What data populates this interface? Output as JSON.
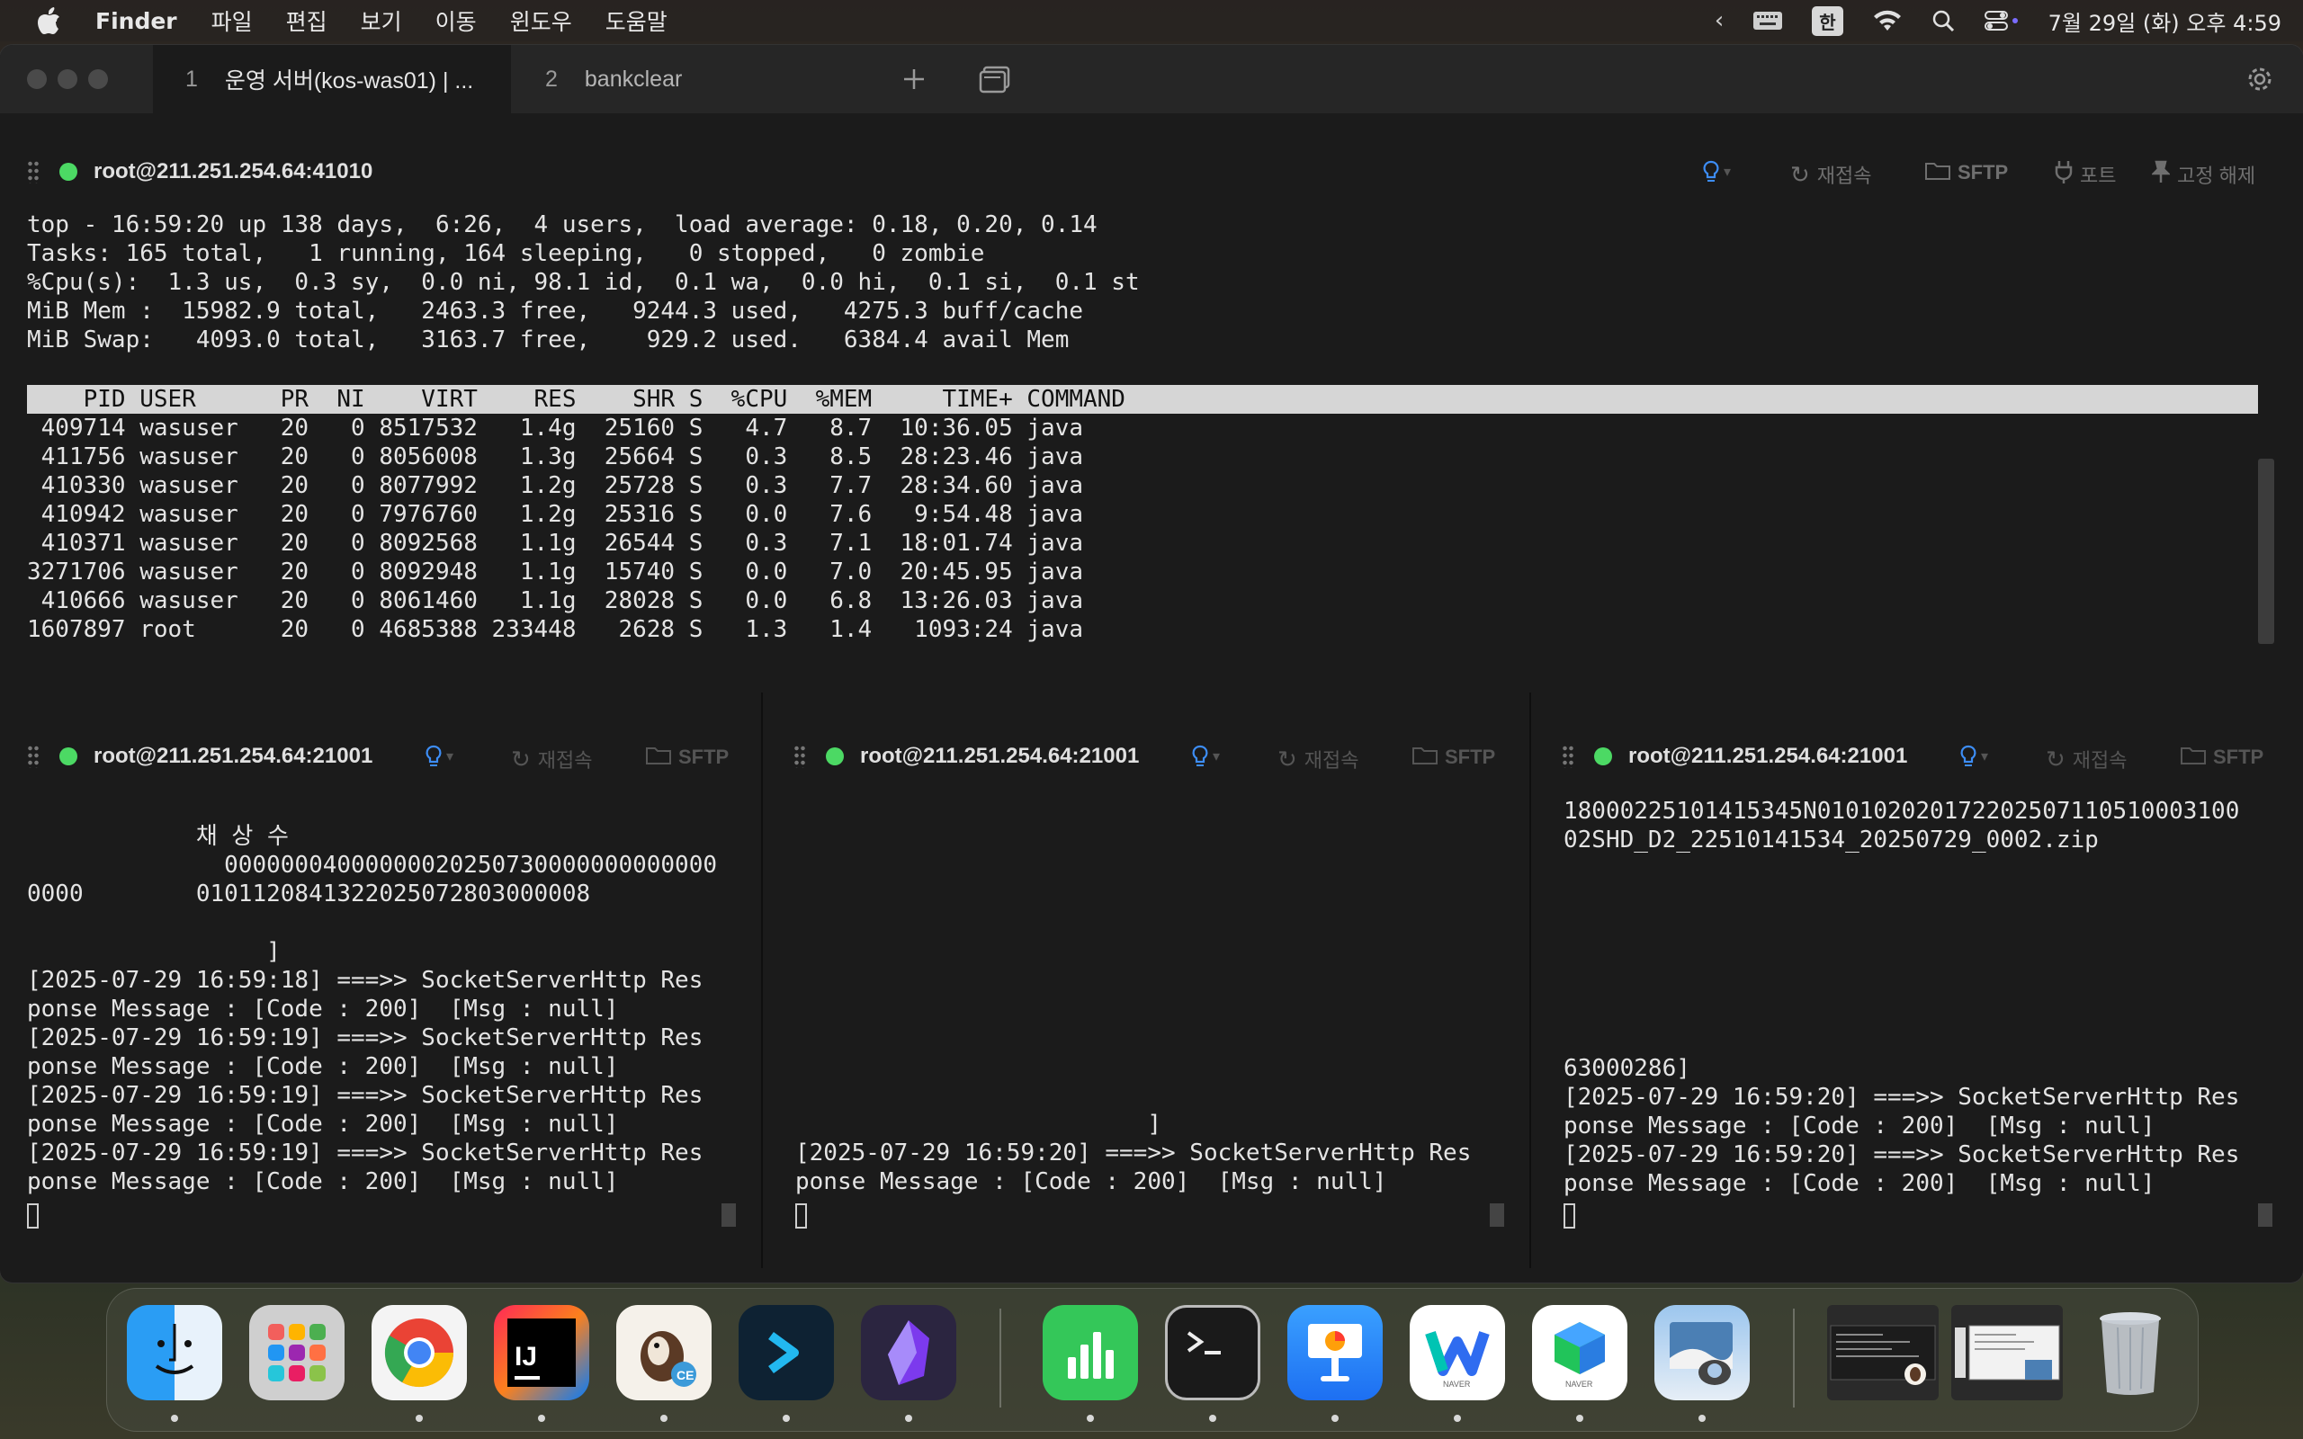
{
  "menubar": {
    "app_name": "Finder",
    "menus": [
      "파일",
      "편집",
      "보기",
      "이동",
      "윈도우",
      "도움말"
    ],
    "input_method": "한",
    "clock": "7월 29일 (화) 오후 4:59"
  },
  "window": {
    "tabs": [
      {
        "num": "1",
        "label": "운영 서버(kos-was01) | ..."
      },
      {
        "num": "2",
        "label": "bankclear"
      }
    ],
    "add_tab_icon": "plus-icon",
    "tab_overview_icon": "tab-overview-icon",
    "settings_icon": "gear-icon"
  },
  "top_session": {
    "host": "root@211.251.254.64:41010",
    "actions": {
      "reconnect": "재접속",
      "sftp": "SFTP",
      "port": "포트",
      "unpin": "고정 해제"
    },
    "summary": "top - 16:59:20 up 138 days,  6:26,  4 users,  load average: 0.18, 0.20, 0.14\nTasks: 165 total,   1 running, 164 sleeping,   0 stopped,   0 zombie\n%Cpu(s):  1.3 us,  0.3 sy,  0.0 ni, 98.1 id,  0.1 wa,  0.0 hi,  0.1 si,  0.1 st\nMiB Mem :  15982.9 total,   2463.3 free,   9244.3 used,   4275.3 buff/cache\nMiB Swap:   4093.0 total,   3163.7 free,    929.2 used.   6384.4 avail Mem",
    "table_header": "    PID USER      PR  NI    VIRT    RES    SHR S  %CPU  %MEM     TIME+ COMMAND",
    "rows": " 409714 wasuser   20   0 8517532   1.4g  25160 S   4.7   8.7  10:36.05 java\n 411756 wasuser   20   0 8056008   1.3g  25664 S   0.3   8.5  28:23.46 java\n 410330 wasuser   20   0 8077992   1.2g  25728 S   0.3   7.7  28:34.60 java\n 410942 wasuser   20   0 7976760   1.2g  25316 S   0.0   7.6   9:54.48 java\n 410371 wasuser   20   0 8092568   1.1g  26544 S   0.3   7.1  18:01.74 java\n3271706 wasuser   20   0 8092948   1.1g  15740 S   0.0   7.0  20:45.95 java\n 410666 wasuser   20   0 8061460   1.1g  28028 S   0.0   6.8  13:26.03 java\n1607897 root      20   0 4685388 233448   2628 S   1.3   1.4   1093:24 java"
  },
  "panes": [
    {
      "host": "root@211.251.254.64:21001",
      "reconnect": "재접속",
      "sftp": "SFTP",
      "output": "            채 상 수\n              00000004000000020250730000000000000\n0000        0101120841322025072803000008\n\n                 ]\n[2025-07-29 16:59:18] ===>> SocketServerHttp Res\nponse Message : [Code : 200]  [Msg : null]\n[2025-07-29 16:59:19] ===>> SocketServerHttp Res\nponse Message : [Code : 200]  [Msg : null]\n[2025-07-29 16:59:19] ===>> SocketServerHttp Res\nponse Message : [Code : 200]  [Msg : null]\n[2025-07-29 16:59:19] ===>> SocketServerHttp Res\nponse Message : [Code : 200]  [Msg : null]"
    },
    {
      "host": "root@211.251.254.64:21001",
      "reconnect": "재접속",
      "sftp": "SFTP",
      "output": "                         ]\n[2025-07-29 16:59:20] ===>> SocketServerHttp Res\nponse Message : [Code : 200]  [Msg : null]"
    },
    {
      "host": "root@211.251.254.64:21001",
      "reconnect": "재접속",
      "sftp": "SFTP",
      "output_top": "18000225101415345N010102020172202507110510003100\n02SHD_D2_22510141534_20250729_0002.zip",
      "output_bottom": "63000286]\n[2025-07-29 16:59:20] ===>> SocketServerHttp Res\nponse Message : [Code : 200]  [Msg : null]\n[2025-07-29 16:59:20] ===>> SocketServerHttp Res\nponse Message : [Code : 200]  [Msg : null]"
    }
  ],
  "dock": {
    "apps": [
      "finder-icon",
      "launchpad-icon",
      "chrome-icon",
      "intellij-icon",
      "dbeaver-icon",
      "terminal-app-icon",
      "obsidian-icon",
      "numbers-icon",
      "terminal-icon",
      "keynote-icon",
      "naver-whale-icon",
      "naver-works-icon",
      "preview-icon"
    ],
    "minimized": [
      "window-thumbnail-1",
      "window-thumbnail-2"
    ],
    "trash": "trash-icon",
    "colors": {
      "finder": "#2a9df4",
      "chrome": "#ea4335",
      "intellij": "#fe2857",
      "numbers": "#34c759",
      "keynote": "#1d8cf8",
      "obsidian": "#7c3aed"
    }
  }
}
